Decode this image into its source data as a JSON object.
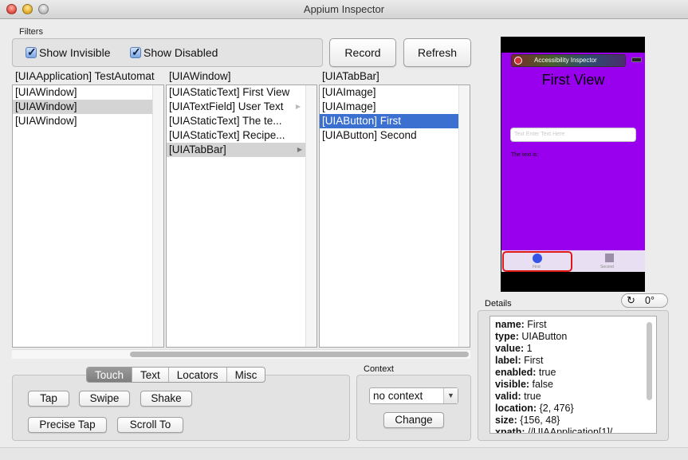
{
  "window": {
    "title": "Appium Inspector"
  },
  "filters": {
    "label": "Filters",
    "show_invisible": {
      "label": "Show Invisible",
      "checked": true
    },
    "show_disabled": {
      "label": "Show Disabled",
      "checked": true
    }
  },
  "toolbar": {
    "record_label": "Record",
    "refresh_label": "Refresh"
  },
  "columns": [
    {
      "header": "[UIAApplication] TestAutomat",
      "items": [
        "[UIAWindow]",
        "[UIAWindow]",
        "[UIAWindow]"
      ]
    },
    {
      "header": "[UIAWindow]",
      "items": [
        "[UIAStaticText] First View",
        "[UIATextField] User Text",
        "[UIAStaticText] The te...",
        "[UIAStaticText] Recipe...",
        "[UIATabBar]"
      ]
    },
    {
      "header": "[UIATabBar]",
      "items": [
        "[UIAImage]",
        "[UIAImage]",
        "[UIAButton] First",
        "[UIAButton] Second"
      ]
    }
  ],
  "tabs": [
    "Touch",
    "Text",
    "Locators",
    "Misc"
  ],
  "actions": {
    "tap": "Tap",
    "swipe": "Swipe",
    "shake": "Shake",
    "precise_tap": "Precise Tap",
    "scroll_to": "Scroll To"
  },
  "context": {
    "label": "Context",
    "selected": "no context",
    "change_label": "Change"
  },
  "preview": {
    "overlay_title": "Accessibility Inspector",
    "view_title": "First View",
    "field_placeholder": "Text Enter Text Here",
    "text": "The text is:",
    "tab_first": "First",
    "tab_second": "Second",
    "screen_color": "#9900ee",
    "highlight_color": "#e01818"
  },
  "rotation": {
    "value": "0°"
  },
  "details": {
    "label": "Details",
    "lines": [
      {
        "key": "name:",
        "value": " First"
      },
      {
        "key": "type:",
        "value": " UIAButton"
      },
      {
        "key": "value:",
        "value": " 1"
      },
      {
        "key": "label:",
        "value": " First"
      },
      {
        "key": "enabled:",
        "value": " true"
      },
      {
        "key": "visible:",
        "value": " false"
      },
      {
        "key": "valid:",
        "value": " true"
      },
      {
        "key": "location:",
        "value": " {2, 476}"
      },
      {
        "key": "size:",
        "value": " {156, 48}"
      },
      {
        "key": "xpath:",
        "value": " //UIAApplication[1]/"
      }
    ]
  }
}
